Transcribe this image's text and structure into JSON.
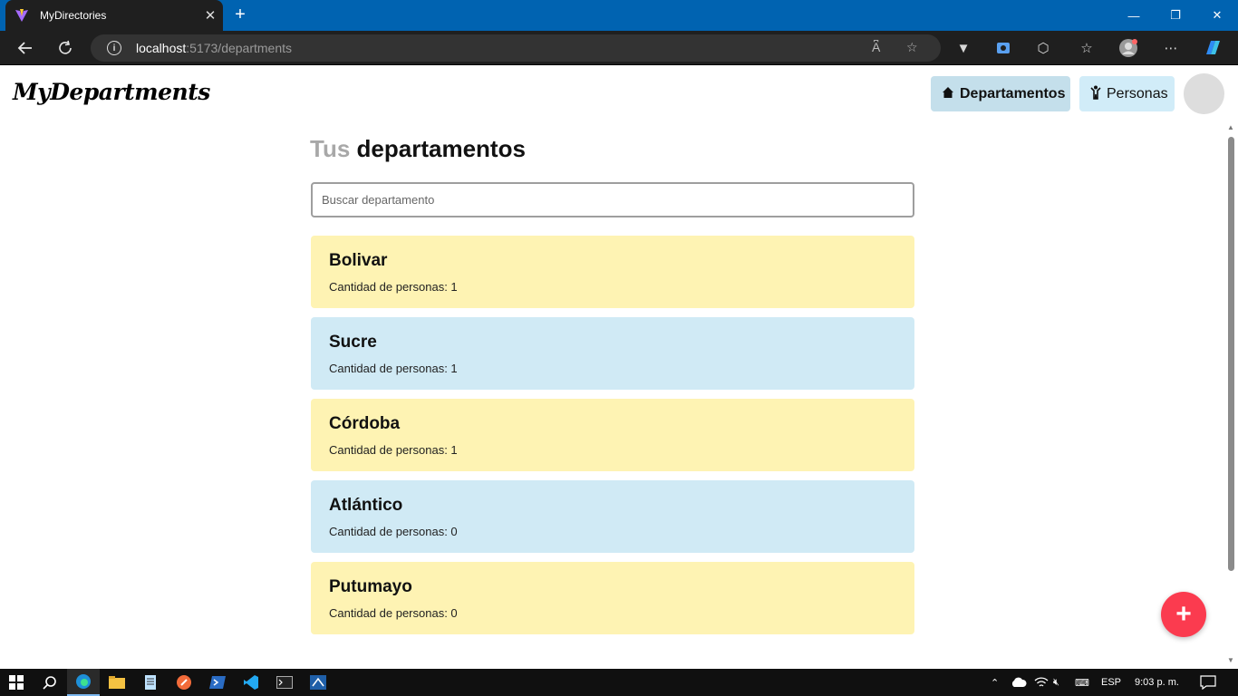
{
  "browser": {
    "tab_title": "MyDirectories",
    "url_host": "localhost",
    "url_path": ":5173/departments",
    "reader_label": "A͆",
    "window": {
      "minimize": "—",
      "restore": "❐",
      "close": "✕"
    }
  },
  "app": {
    "brand": "MyDepartments",
    "nav": {
      "departments_label": "Departamentos",
      "persons_label": "Personas"
    },
    "heading": {
      "prefix": "Tus",
      "main": "departamentos"
    },
    "search": {
      "placeholder": "Buscar departamento",
      "value": ""
    },
    "departments": [
      {
        "name": "Bolivar",
        "count_label": "Cantidad de personas: 1",
        "color": "#fef3b3"
      },
      {
        "name": "Sucre",
        "count_label": "Cantidad de personas: 1",
        "color": "#d0eaf5"
      },
      {
        "name": "Córdoba",
        "count_label": "Cantidad de personas: 1",
        "color": "#fef3b3"
      },
      {
        "name": "Atlántico",
        "count_label": "Cantidad de personas: 0",
        "color": "#d0eaf5"
      },
      {
        "name": "Putumayo",
        "count_label": "Cantidad de personas: 0",
        "color": "#fef3b3"
      }
    ],
    "fab_label": "+",
    "fab_color": "#fb3b4f"
  },
  "taskbar": {
    "language": "ESP",
    "time": "9:03 p. m."
  }
}
